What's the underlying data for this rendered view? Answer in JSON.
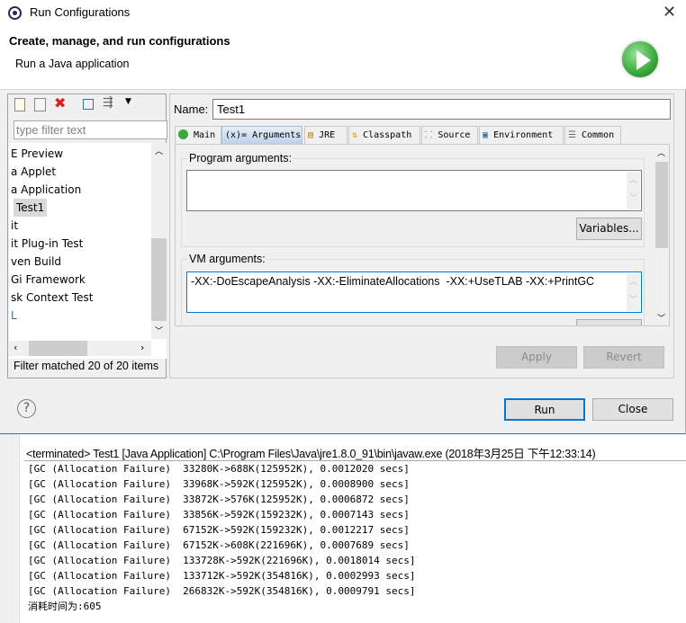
{
  "window": {
    "title": "Run Configurations"
  },
  "header": {
    "title": "Create, manage, and run configurations",
    "subtitle": "Run a Java application"
  },
  "left": {
    "filter_placeholder": "type filter text",
    "items": [
      "E Preview",
      "a Applet",
      "a Application",
      "Test1",
      "it",
      "it Plug-in Test",
      "ven Build",
      "Gi Framework",
      "sk Context Test",
      "L"
    ],
    "selected": "Test1",
    "status": "Filter matched 20 of 20 items"
  },
  "right": {
    "name_label": "Name:",
    "name_value": "Test1",
    "tabs": [
      "Main",
      "Arguments",
      "JRE",
      "Classpath",
      "Source",
      "Environment",
      "Common"
    ],
    "active_tab": "Arguments",
    "program_args_label": "Program arguments:",
    "program_args_value": "",
    "variables_label": "Variables...",
    "vm_args_label": "VM arguments:",
    "vm_args_value": "-XX:-DoEscapeAnalysis -XX:-EliminateAllocations  -XX:+UseTLAB -XX:+PrintGC",
    "apply": "Apply",
    "revert": "Revert"
  },
  "footer": {
    "help": "?",
    "run": "Run",
    "close": "Close"
  },
  "console": {
    "header": "<terminated> Test1 [Java Application] C:\\Program Files\\Java\\jre1.8.0_91\\bin\\javaw.exe (2018年3月25日 下午12:33:14)",
    "lines": [
      "[GC (Allocation Failure)  33280K->688K(125952K), 0.0012020 secs]",
      "[GC (Allocation Failure)  33968K->592K(125952K), 0.0008900 secs]",
      "[GC (Allocation Failure)  33872K->576K(125952K), 0.0006872 secs]",
      "[GC (Allocation Failure)  33856K->592K(159232K), 0.0007143 secs]",
      "[GC (Allocation Failure)  67152K->592K(159232K), 0.0012217 secs]",
      "[GC (Allocation Failure)  67152K->608K(221696K), 0.0007689 secs]",
      "[GC (Allocation Failure)  133728K->592K(221696K), 0.0018014 secs]",
      "[GC (Allocation Failure)  133712K->592K(354816K), 0.0002993 secs]",
      "[GC (Allocation Failure)  266832K->592K(354816K), 0.0009791 secs]",
      "消耗时间为:605"
    ]
  },
  "colors": {
    "accent": "#0078d7",
    "run_icon": "#3aa83a"
  }
}
